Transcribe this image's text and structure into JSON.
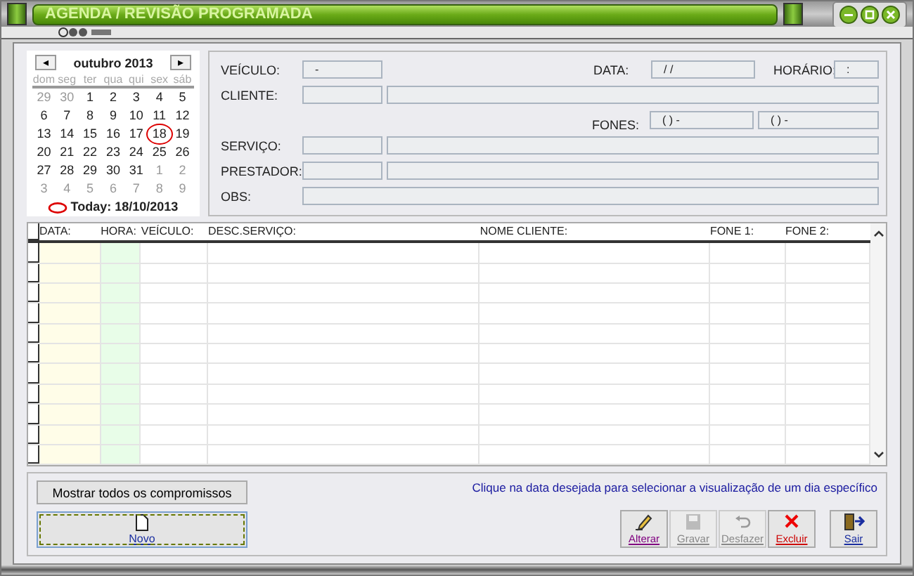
{
  "window": {
    "title": "AGENDA / REVISÃO PROGRAMADA"
  },
  "calendar": {
    "month": "outubro 2013",
    "prev": "◂",
    "next": "▸",
    "weekdays": [
      "dom",
      "seg",
      "ter",
      "qua",
      "qui",
      "sex",
      "sáb"
    ],
    "weeks": [
      [
        {
          "day": "29",
          "muted": true,
          "selected": false
        },
        {
          "day": "30",
          "muted": true,
          "selected": false
        },
        {
          "day": "1",
          "muted": false,
          "selected": false
        },
        {
          "day": "2",
          "muted": false,
          "selected": false
        },
        {
          "day": "3",
          "muted": false,
          "selected": false
        },
        {
          "day": "4",
          "muted": false,
          "selected": false
        },
        {
          "day": "5",
          "muted": false,
          "selected": false
        }
      ],
      [
        {
          "day": "6",
          "muted": false,
          "selected": false
        },
        {
          "day": "7",
          "muted": false,
          "selected": false
        },
        {
          "day": "8",
          "muted": false,
          "selected": false
        },
        {
          "day": "9",
          "muted": false,
          "selected": false
        },
        {
          "day": "10",
          "muted": false,
          "selected": false
        },
        {
          "day": "11",
          "muted": false,
          "selected": false
        },
        {
          "day": "12",
          "muted": false,
          "selected": false
        }
      ],
      [
        {
          "day": "13",
          "muted": false,
          "selected": false
        },
        {
          "day": "14",
          "muted": false,
          "selected": false
        },
        {
          "day": "15",
          "muted": false,
          "selected": false
        },
        {
          "day": "16",
          "muted": false,
          "selected": false
        },
        {
          "day": "17",
          "muted": false,
          "selected": false
        },
        {
          "day": "18",
          "muted": false,
          "selected": true
        },
        {
          "day": "19",
          "muted": false,
          "selected": false
        }
      ],
      [
        {
          "day": "20",
          "muted": false,
          "selected": false
        },
        {
          "day": "21",
          "muted": false,
          "selected": false
        },
        {
          "day": "22",
          "muted": false,
          "selected": false
        },
        {
          "day": "23",
          "muted": false,
          "selected": false
        },
        {
          "day": "24",
          "muted": false,
          "selected": false
        },
        {
          "day": "25",
          "muted": false,
          "selected": false
        },
        {
          "day": "26",
          "muted": false,
          "selected": false
        }
      ],
      [
        {
          "day": "27",
          "muted": false,
          "selected": false
        },
        {
          "day": "28",
          "muted": false,
          "selected": false
        },
        {
          "day": "29",
          "muted": false,
          "selected": false
        },
        {
          "day": "30",
          "muted": false,
          "selected": false
        },
        {
          "day": "31",
          "muted": false,
          "selected": false
        },
        {
          "day": "1",
          "muted": true,
          "selected": false
        },
        {
          "day": "2",
          "muted": true,
          "selected": false
        }
      ],
      [
        {
          "day": "3",
          "muted": true,
          "selected": false
        },
        {
          "day": "4",
          "muted": true,
          "selected": false
        },
        {
          "day": "5",
          "muted": true,
          "selected": false
        },
        {
          "day": "6",
          "muted": true,
          "selected": false
        },
        {
          "day": "7",
          "muted": true,
          "selected": false
        },
        {
          "day": "8",
          "muted": true,
          "selected": false
        },
        {
          "day": "9",
          "muted": true,
          "selected": false
        }
      ]
    ],
    "today": "Today: 18/10/2013"
  },
  "form": {
    "veiculo": {
      "label": "VEÍCULO:",
      "value": "-"
    },
    "data": {
      "label": "DATA:",
      "value": "/ /"
    },
    "horario": {
      "label": "HORÁRIO:",
      "value": ":"
    },
    "cliente": {
      "label": "CLIENTE:"
    },
    "fones": {
      "label": "FONES:",
      "values": [
        "( )  -",
        "( )  -"
      ]
    },
    "servico": {
      "label": "SERVIÇO:"
    },
    "prestador": {
      "label": "PRESTADOR:"
    },
    "obs": {
      "label": "OBS:"
    }
  },
  "table": {
    "columns": [
      {
        "label": "DATA:",
        "color": "#fffde8"
      },
      {
        "label": "HORA:",
        "color": "#e8fde8"
      },
      {
        "label": "VEÍCULO:",
        "color": "#ffffff"
      },
      {
        "label": "DESC.SERVIÇO:",
        "color": "#ffffff"
      },
      {
        "label": "NOME CLIENTE:",
        "color": "#ffffff"
      },
      {
        "label": "FONE 1:",
        "color": "#ffffff"
      },
      {
        "label": "FONE 2:",
        "color": "#ffffff"
      }
    ]
  },
  "show_all_button": "Mostrar todos os compromissos",
  "hint": "Clique na data desejada para selecionar a visualização de um dia específico",
  "new_button": {
    "label": "Novo",
    "focused": true
  },
  "actions": [
    {
      "kind": "edit",
      "label": "Alterar",
      "disabled": false
    },
    {
      "kind": "save",
      "label": "Gravar",
      "disabled": true
    },
    {
      "kind": "undo",
      "label": "Desfazer",
      "disabled": true
    },
    {
      "kind": "delete",
      "label": "Excluir",
      "disabled": false
    }
  ],
  "exit_button": {
    "label": "Sair"
  }
}
